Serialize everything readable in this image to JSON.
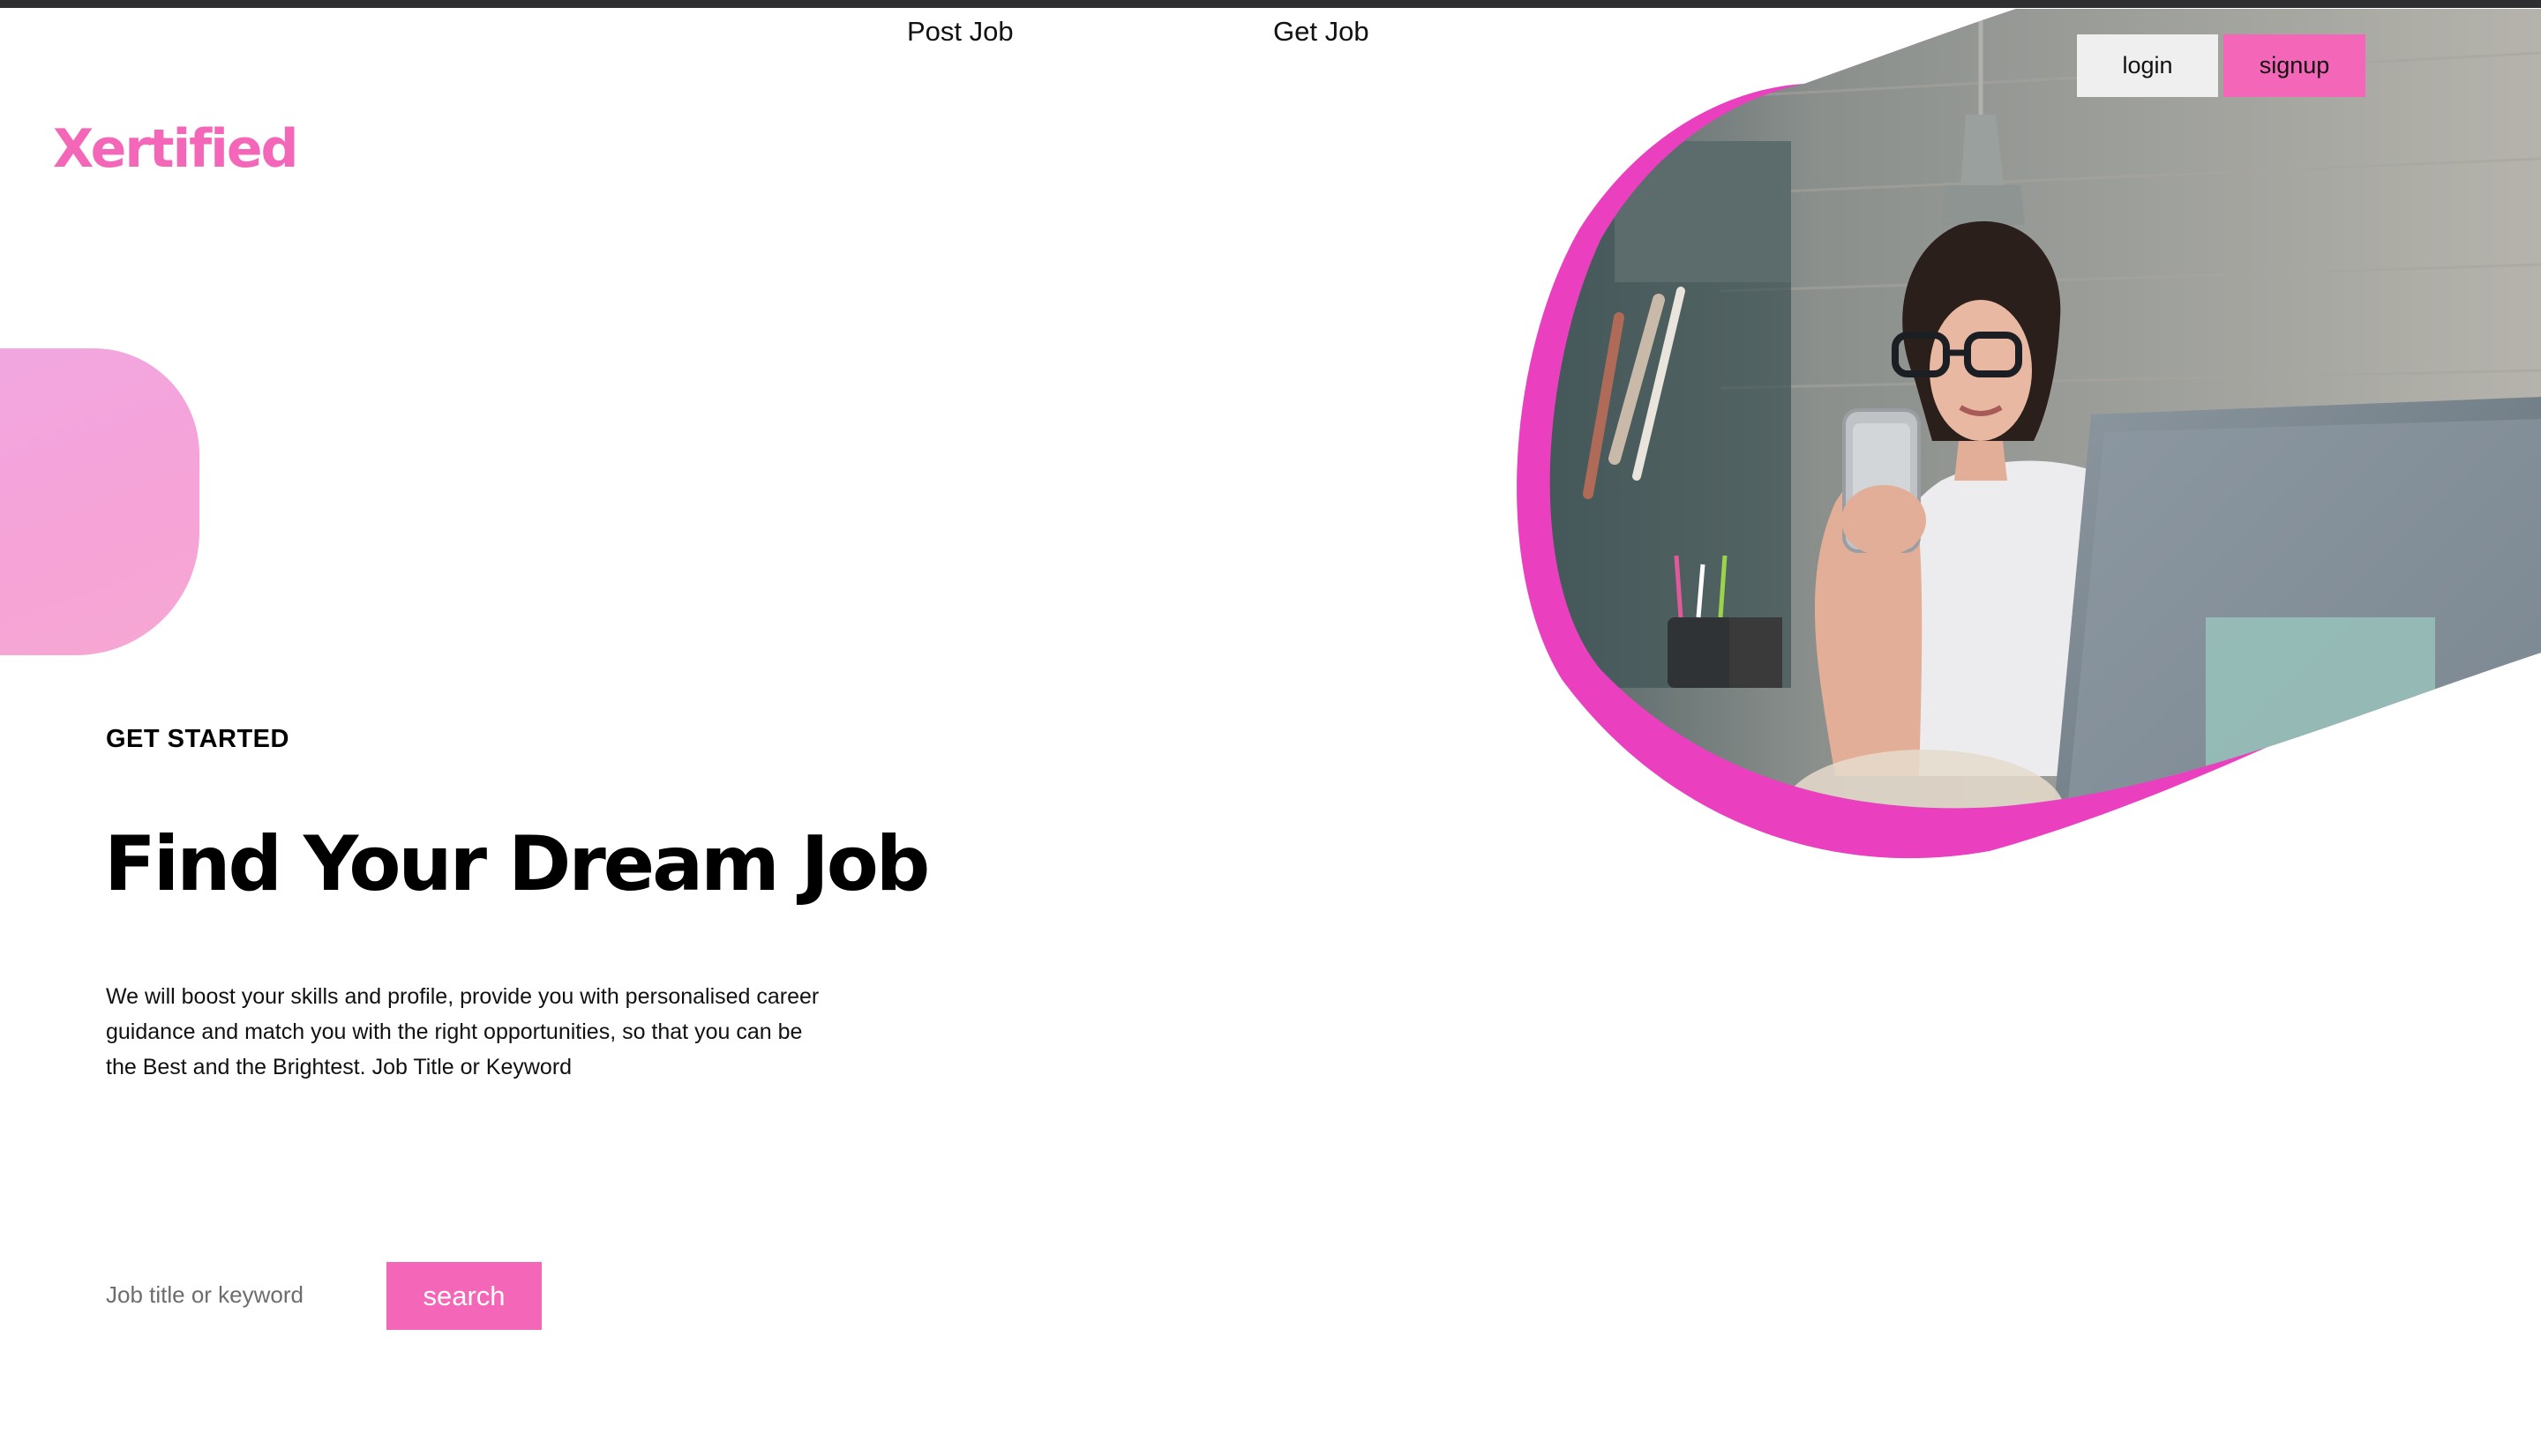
{
  "colors": {
    "brand_pink": "#f466b7",
    "frame_magenta": "#ea3fbf",
    "blob_pink": "#f5a5d9",
    "login_gray": "#efefef",
    "top_bar": "#2f2f31"
  },
  "nav": {
    "post_job": "Post Job",
    "get_job": "Get Job"
  },
  "auth": {
    "login": "login",
    "signup": "signup"
  },
  "brand": {
    "logo": "Xertified"
  },
  "hero": {
    "eyebrow": "GET STARTED",
    "headline": "Find Your Dream Job",
    "description": "We will boost your skills and profile, provide you with personalised career guidance and match you with the right opportunities, so that you can be the Best and the Brightest. Job Title or Keyword",
    "photo": "woman-with-glasses-holding-phone-at-laptop"
  },
  "search": {
    "placeholder": "Job title or keyword",
    "button": "search"
  }
}
